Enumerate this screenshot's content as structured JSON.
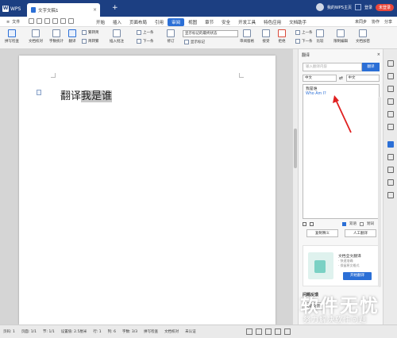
{
  "titlebar": {
    "app_label": "WPS",
    "doc_tab": "文字文稿1",
    "new_tab": "+",
    "user_text": "我的WPS主页",
    "account": "登录",
    "badge": "未登录"
  },
  "menubar": {
    "file_label": "文件",
    "menus": [
      "开始",
      "插入",
      "页面布局",
      "引用",
      "审阅",
      "视图",
      "章节",
      "安全",
      "开发工具",
      "特色应用",
      "文档助手"
    ],
    "active_menu": "审阅",
    "right_items": [
      "未同步",
      "协作",
      "分享"
    ]
  },
  "toolbar": {
    "buttons": [
      "拼写检查",
      "文档校对",
      "字数统计",
      "翻译",
      "插入批注",
      "修订",
      "审阅窗格",
      "接受",
      "拒绝",
      "比较",
      "限制编辑",
      "文档加密"
    ],
    "rows": [
      "繁转简",
      "简转繁",
      "上一条",
      "下一条",
      "显示标记",
      "上一条",
      "下一条"
    ],
    "markup_select": "显示标记的最终状态"
  },
  "document": {
    "text_plain": "翻译",
    "text_selected": "我是谁"
  },
  "panel": {
    "title": "翻译",
    "close": "×",
    "input_placeholder": "输入翻译内容",
    "translate_button": "翻译",
    "source_lang": "中文",
    "swap": "⇄",
    "target_lang": "中文",
    "result_source": "我是谁",
    "result_target": "Who Am I?",
    "option_bilingual": "双语",
    "option_hide": "划词",
    "btn_copy": "复制释义",
    "btn_human": "人工翻译",
    "card_title": "文档全文翻译",
    "card_line1": "· 快速准确",
    "card_line2": "· 保留原文格式",
    "card_button": "开始翻译",
    "feedback_title": "问题反馈",
    "feedback_button": "问题反馈"
  },
  "status": {
    "items": [
      "页码: 1",
      "页面: 1/1",
      "节: 1/1",
      "设置值: 2.5厘米",
      "行: 1",
      "列: 6",
      "字数: 3/3",
      "拼写检查",
      "文档校对",
      "未认证"
    ],
    "zoom": "100%"
  },
  "watermark": {
    "big": "软件无忧",
    "small": "努力解决软件问题"
  }
}
